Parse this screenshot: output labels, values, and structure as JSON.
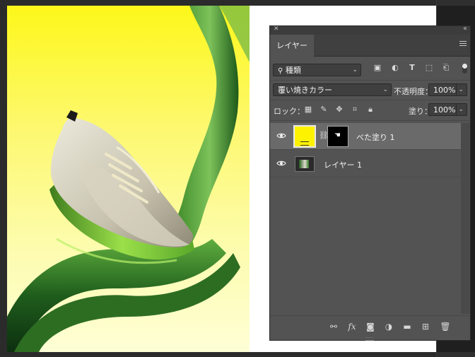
{
  "panel": {
    "tab_label": "レイヤー",
    "filter": {
      "kind_label": "種類"
    },
    "blend": {
      "mode": "覆い焼きカラー",
      "opacity_label": "不透明度：",
      "opacity_value": "100%"
    },
    "lock": {
      "label": "ロック：",
      "fill_label": "塗り：",
      "fill_value": "100%"
    },
    "layers": [
      {
        "name": "べた塗り 1",
        "selected": true,
        "thumb_color": "#fdf200"
      },
      {
        "name": "レイヤー 1",
        "selected": false
      }
    ]
  },
  "colors": {
    "panel_bg": "#535353",
    "selected_row": "#6a6a6a",
    "fill_layer_yellow": "#fdf200",
    "canvas_yellow": "#fdf71a"
  }
}
